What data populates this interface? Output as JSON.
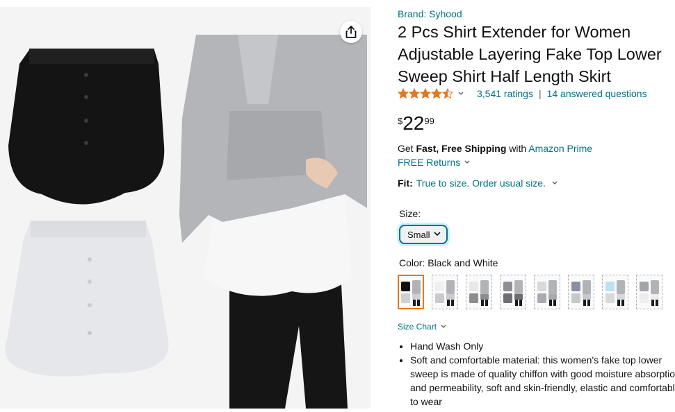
{
  "product": {
    "brand": "Brand: Syhood",
    "title": "2 Pcs Shirt Extender for Women Adjustable Layering Fake Top Lower Sweep Shirt Half Length Skirt",
    "rating": 4.5,
    "ratings_text": "3,541 ratings",
    "separator": "|",
    "answered_text": "14 answered questions",
    "price": {
      "symbol": "$",
      "whole": "22",
      "fraction": "99"
    },
    "shipping": {
      "prefix": "Get ",
      "bold": "Fast, Free Shipping",
      "middle": " with ",
      "prime": "Amazon Prime"
    },
    "returns": "FREE Returns",
    "fit": {
      "label": "Fit:",
      "value": "True to size. Order usual size."
    },
    "size": {
      "label": "Size:",
      "selected": "Small"
    },
    "color": {
      "label": "Color: ",
      "value": "Black and White"
    },
    "swatches": [
      "black-white",
      "white",
      "white-grey",
      "dark-grey",
      "light-grey",
      "blue-grey",
      "light-blue",
      "grey-white"
    ],
    "size_chart": "Size Chart",
    "bullets": [
      "Hand Wash Only",
      "Soft and comfortable material: this women's fake top lower sweep is made of quality chiffon with good moisture absorption and permeability, soft and skin-friendly, elastic and comfortable to wear"
    ]
  },
  "icons": {
    "share": "share-icon",
    "star": "star-icon",
    "chevron": "chevron-down-icon"
  },
  "colors": {
    "link": "#007185",
    "star": "#DE7921",
    "selected_border": "#E77600",
    "text": "#0F1111"
  }
}
